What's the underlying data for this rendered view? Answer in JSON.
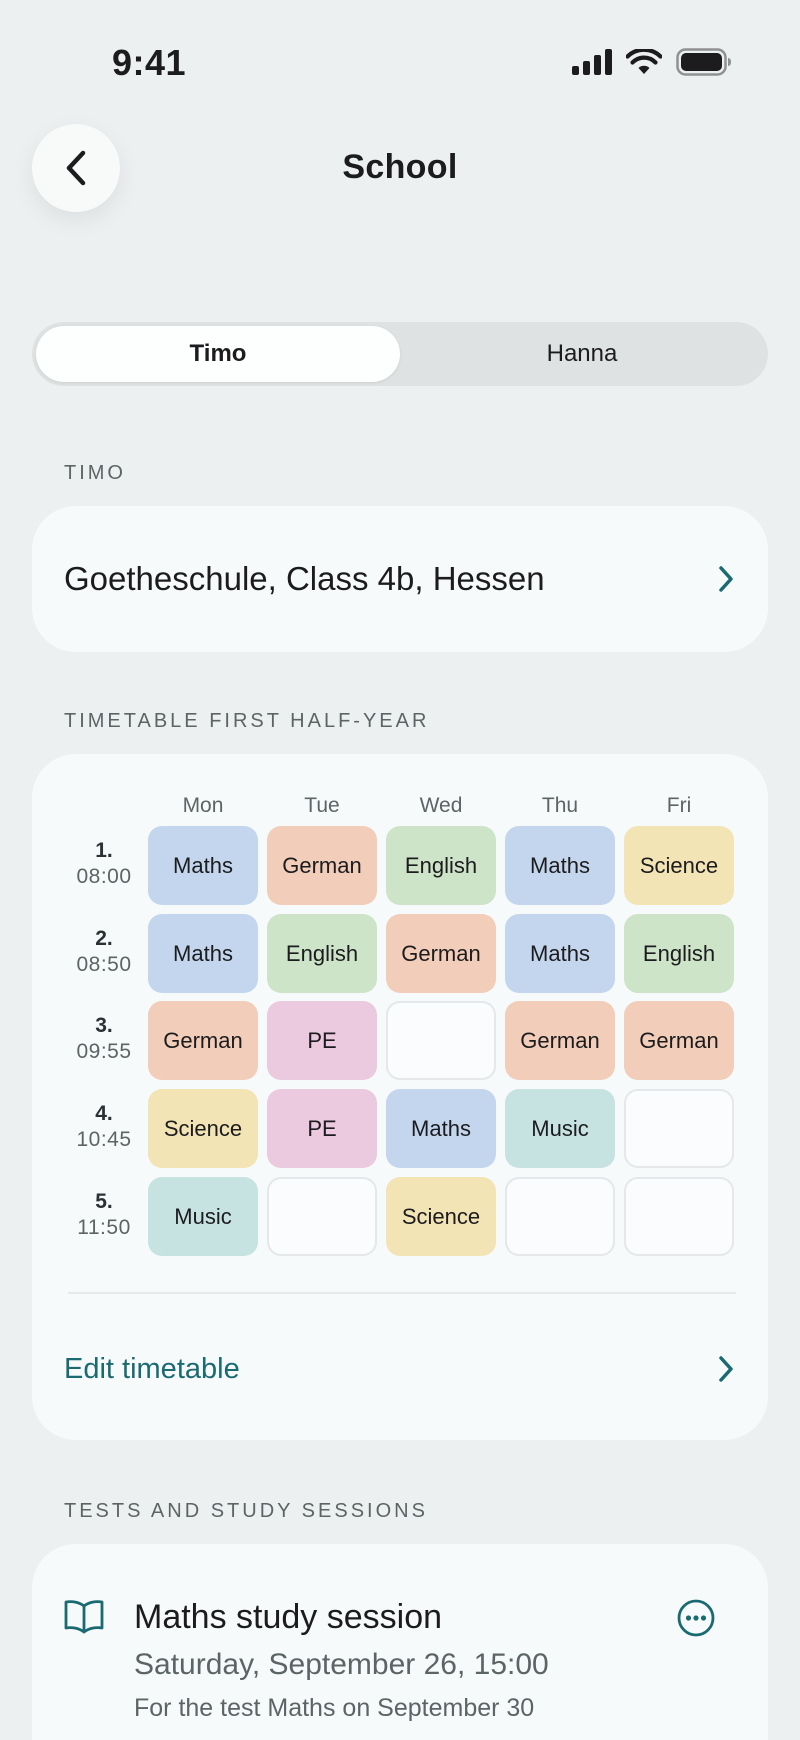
{
  "status_bar": {
    "time": "9:41"
  },
  "header": {
    "title": "School"
  },
  "tabs": [
    {
      "label": "Timo",
      "active": true
    },
    {
      "label": "Hanna",
      "active": false
    }
  ],
  "child_section": {
    "label": "TIMO",
    "school": "Goetheschule, Class 4b, Hessen"
  },
  "timetable": {
    "label": "TIMETABLE FIRST HALF-YEAR",
    "days": [
      "Mon",
      "Tue",
      "Wed",
      "Thu",
      "Fri"
    ],
    "periods": [
      {
        "num": "1.",
        "time": "08:00",
        "lessons": [
          "Maths",
          "German",
          "English",
          "Maths",
          "Science"
        ]
      },
      {
        "num": "2.",
        "time": "08:50",
        "lessons": [
          "Maths",
          "English",
          "German",
          "Maths",
          "English"
        ]
      },
      {
        "num": "3.",
        "time": "09:55",
        "lessons": [
          "German",
          "PE",
          "",
          "German",
          "German"
        ]
      },
      {
        "num": "4.",
        "time": "10:45",
        "lessons": [
          "Science",
          "PE",
          "Maths",
          "Music",
          ""
        ]
      },
      {
        "num": "5.",
        "time": "11:50",
        "lessons": [
          "Music",
          "",
          "Science",
          "",
          ""
        ]
      }
    ],
    "subject_colors": {
      "Maths": "#c3d6ee",
      "German": "#f2cdb9",
      "English": "#cde4c9",
      "Science": "#f3e4b5",
      "PE": "#ebc9df",
      "Music": "#c7e3e1"
    },
    "edit_label": "Edit timetable"
  },
  "tests": {
    "label": "TESTS AND STUDY SESSIONS",
    "items": [
      {
        "icon": "book-icon",
        "title": "Maths study session",
        "date": "Saturday, September 26, 15:00",
        "note": "For the test Maths on September 30"
      }
    ]
  },
  "colors": {
    "background": "#edf0f0",
    "card": "#f7fafb",
    "accent": "#1a6a72",
    "secondary_text": "#5d6466"
  }
}
